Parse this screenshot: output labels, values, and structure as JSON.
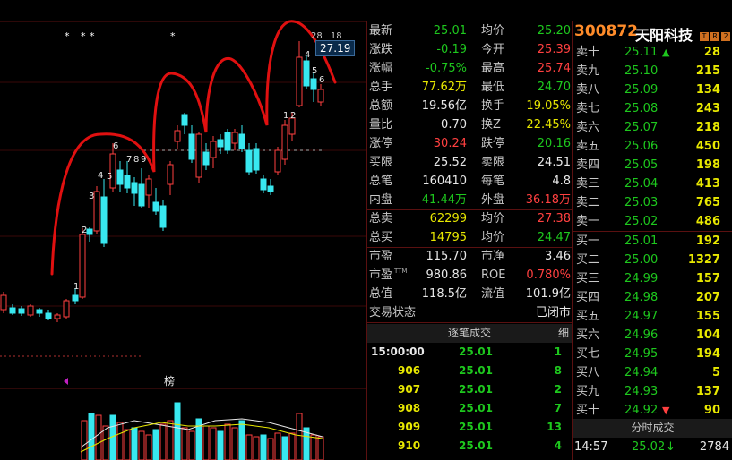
{
  "chart": {
    "last_price_tag": "27.19",
    "top_labels": [
      "28",
      "18"
    ],
    "stars": [
      "*",
      "*",
      "*",
      "*"
    ],
    "billboard_label": "榜",
    "candle_labels": [
      "1",
      "2",
      "3",
      "4",
      "5",
      "6",
      "7",
      "8",
      "9",
      "1",
      "2",
      "4",
      "5",
      "6"
    ]
  },
  "quote": {
    "rows": [
      {
        "l1": "最新",
        "v1": "25.01",
        "c1": "down",
        "l2": "均价",
        "v2": "25.20",
        "c2": "down"
      },
      {
        "l1": "涨跌",
        "v1": "-0.19",
        "c1": "down",
        "l2": "今开",
        "v2": "25.39",
        "c2": "up"
      },
      {
        "l1": "涨幅",
        "v1": "-0.75%",
        "c1": "down",
        "l2": "最高",
        "v2": "25.74",
        "c2": "up"
      },
      {
        "l1": "总手",
        "v1": "77.62万",
        "c1": "yellow",
        "l2": "最低",
        "v2": "24.70",
        "c2": "down"
      },
      {
        "l1": "总额",
        "v1": "19.56亿",
        "c1": "white",
        "l2": "换手",
        "v2": "19.05%",
        "c2": "yellow"
      },
      {
        "l1": "量比",
        "v1": "0.70",
        "c1": "white",
        "l2": "换Z",
        "v2": "22.45%",
        "c2": "yellow"
      },
      {
        "l1": "涨停",
        "v1": "30.24",
        "c1": "up",
        "l2": "跌停",
        "v2": "20.16",
        "c2": "down"
      },
      {
        "l1": "买限",
        "v1": "25.52",
        "c1": "white",
        "l2": "卖限",
        "v2": "24.51",
        "c2": "white"
      },
      {
        "l1": "总笔",
        "v1": "160410",
        "c1": "white",
        "l2": "每笔",
        "v2": "4.8",
        "c2": "white"
      },
      {
        "l1": "内盘",
        "v1": "41.44万",
        "c1": "down",
        "l2": "外盘",
        "v2": "36.18万",
        "c2": "up"
      },
      {
        "l1": "总卖",
        "v1": "62299",
        "c1": "yellow",
        "l2": "均价",
        "v2": "27.38",
        "c2": "up"
      },
      {
        "l1": "总买",
        "v1": "14795",
        "c1": "yellow",
        "l2": "均价",
        "v2": "24.47",
        "c2": "down"
      },
      {
        "l1": "市盈",
        "v1": "115.70",
        "c1": "white",
        "l2": "市净",
        "v2": "3.46",
        "c2": "white"
      },
      {
        "l1": "市盈",
        "v1": "980.86",
        "c1": "white",
        "l2": "ROE",
        "v2": "0.780%",
        "c2": "up"
      },
      {
        "l1": "总值",
        "v1": "118.5亿",
        "c1": "white",
        "l2": "流值",
        "v2": "101.9亿",
        "c2": "white"
      },
      {
        "l1": "交易状态",
        "v1": "",
        "c1": "white",
        "l2": "",
        "v2": "已闭市",
        "c2": "white"
      }
    ],
    "pe_sup": "TTM"
  },
  "trades": {
    "header": "逐笔成交",
    "header_right": "细",
    "rows": [
      {
        "t": "15:00:00",
        "p": "25.01",
        "v": "1"
      },
      {
        "t": "906",
        "p": "25.01",
        "v": "8"
      },
      {
        "t": "907",
        "p": "25.01",
        "v": "2"
      },
      {
        "t": "908",
        "p": "25.01",
        "v": "7"
      },
      {
        "t": "909",
        "p": "25.01",
        "v": "13"
      },
      {
        "t": "910",
        "p": "25.01",
        "v": "4"
      }
    ]
  },
  "orderbook": {
    "code": "300872",
    "name": "天阳科技",
    "badges": [
      "T",
      "R",
      "2"
    ],
    "asks": [
      {
        "label": "卖十",
        "price": "25.11",
        "vol": "28",
        "arrow": "▲"
      },
      {
        "label": "卖九",
        "price": "25.10",
        "vol": "215"
      },
      {
        "label": "卖八",
        "price": "25.09",
        "vol": "134"
      },
      {
        "label": "卖七",
        "price": "25.08",
        "vol": "243"
      },
      {
        "label": "卖六",
        "price": "25.07",
        "vol": "218"
      },
      {
        "label": "卖五",
        "price": "25.06",
        "vol": "450"
      },
      {
        "label": "卖四",
        "price": "25.05",
        "vol": "198"
      },
      {
        "label": "卖三",
        "price": "25.04",
        "vol": "413"
      },
      {
        "label": "卖二",
        "price": "25.03",
        "vol": "765"
      },
      {
        "label": "卖一",
        "price": "25.02",
        "vol": "486"
      }
    ],
    "bids": [
      {
        "label": "买一",
        "price": "25.01",
        "vol": "192"
      },
      {
        "label": "买二",
        "price": "25.00",
        "vol": "1327"
      },
      {
        "label": "买三",
        "price": "24.99",
        "vol": "157"
      },
      {
        "label": "买四",
        "price": "24.98",
        "vol": "207"
      },
      {
        "label": "买五",
        "price": "24.97",
        "vol": "155"
      },
      {
        "label": "买六",
        "price": "24.96",
        "vol": "104"
      },
      {
        "label": "买七",
        "price": "24.95",
        "vol": "194"
      },
      {
        "label": "买八",
        "price": "24.94",
        "vol": "5"
      },
      {
        "label": "买九",
        "price": "24.93",
        "vol": "137"
      },
      {
        "label": "买十",
        "price": "24.92",
        "vol": "90",
        "arrow": "▼"
      }
    ],
    "minute_header": "分时成交",
    "minute_row": {
      "t": "14:57",
      "p": "25.02",
      "arrow": "↓",
      "v": "2784"
    }
  },
  "colors": {
    "up": "#ff4040",
    "down": "#1ec81e",
    "accent": "#e8e800",
    "border": "#5a1010",
    "brand": "#ff8c2a"
  }
}
